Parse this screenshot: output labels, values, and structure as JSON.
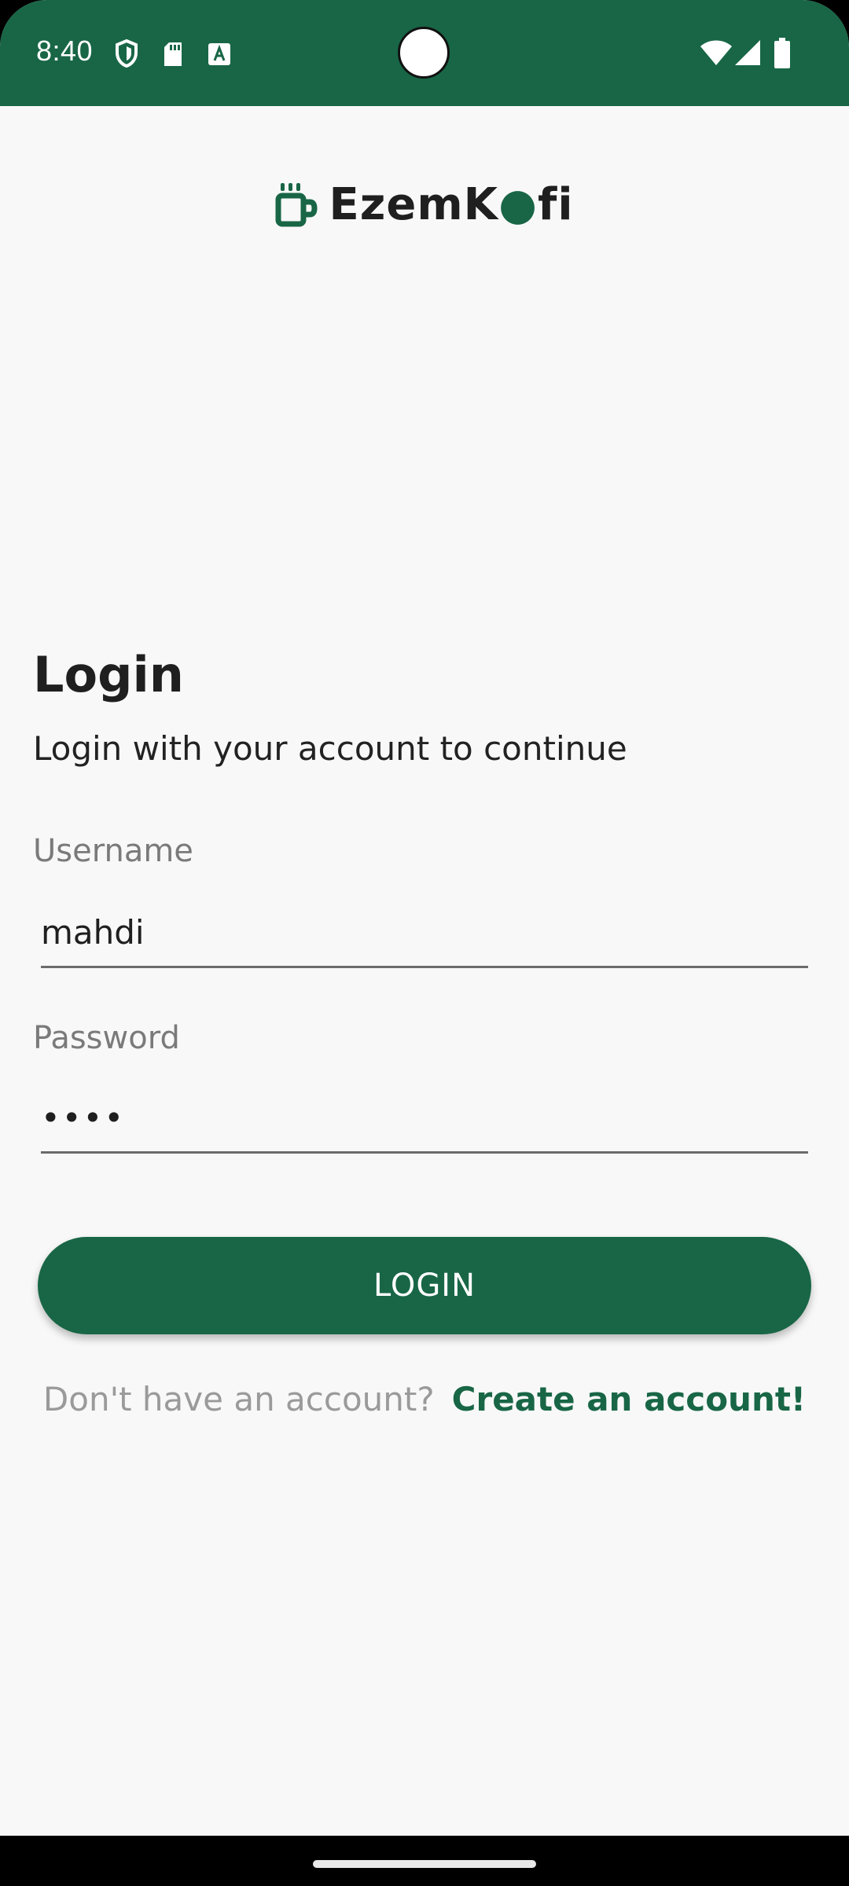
{
  "status_bar": {
    "time": "8:40",
    "left_icons": [
      "shield-icon",
      "sd-card-icon",
      "font-a-icon"
    ],
    "right_icons": [
      "wifi-icon",
      "signal-icon",
      "battery-icon"
    ],
    "background": "#186646"
  },
  "brand": {
    "name_part1": "Ezem",
    "name_part2": "K",
    "name_part3": "fi",
    "logo_icon": "coffee-cup-icon",
    "accent_color": "#186646"
  },
  "login": {
    "title": "Login",
    "subtitle": "Login with your account to continue",
    "username_label": "Username",
    "username_value": "mahdi",
    "password_label": "Password",
    "password_value": "••••",
    "button_label": "LOGIN"
  },
  "signup": {
    "prompt": "Don't have an account?",
    "link": "Create an account!"
  }
}
